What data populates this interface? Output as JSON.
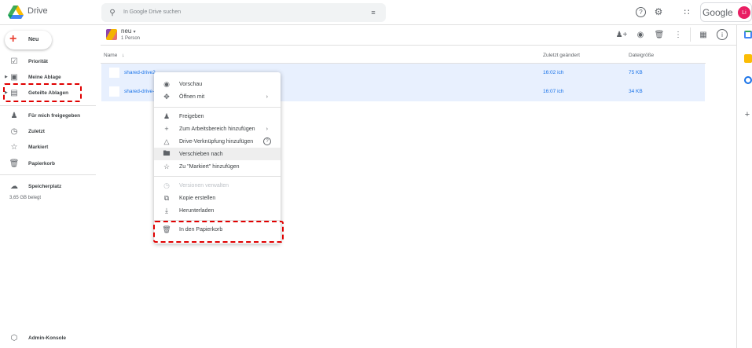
{
  "header": {
    "app_name": "Drive",
    "search_placeholder": "In Google Drive suchen",
    "account_brand": "Google",
    "avatar_initials": "Li"
  },
  "sidebar": {
    "new_label": "Neu",
    "items": [
      {
        "label": "Priorität"
      },
      {
        "label": "Meine Ablage"
      },
      {
        "label": "Geteilte Ablagen"
      },
      {
        "label": "Für mich freigegeben"
      },
      {
        "label": "Zuletzt"
      },
      {
        "label": "Markiert"
      },
      {
        "label": "Papierkorb"
      },
      {
        "label": "Speicherplatz"
      }
    ],
    "storage_used": "3,65 GB belegt",
    "admin_label": "Admin-Konsole"
  },
  "folder": {
    "name": "neu",
    "members": "1 Person"
  },
  "table": {
    "columns": [
      "Name",
      "Zuletzt geändert",
      "Dateigröße"
    ],
    "rows": [
      {
        "name": "shared-drive2",
        "modified": "16:02  ich",
        "size": "75 KB"
      },
      {
        "name": "shared-drive-",
        "modified": "16:07  ich",
        "size": "34 KB"
      }
    ]
  },
  "context_menu": {
    "items": [
      {
        "label": "Vorschau"
      },
      {
        "label": "Öffnen mit"
      },
      {
        "label": "Freigeben"
      },
      {
        "label": "Zum Arbeitsbereich hinzufügen"
      },
      {
        "label": "Drive-Verknüpfung hinzufügen"
      },
      {
        "label": "Verschieben nach"
      },
      {
        "label": "Zu \"Markiert\" hinzufügen"
      },
      {
        "label": "Versionen verwalten"
      },
      {
        "label": "Kopie erstellen"
      },
      {
        "label": "Herunterladen"
      },
      {
        "label": "In den Papierkorb"
      }
    ]
  },
  "colors": {
    "accent": "#1a73e8",
    "selection": "#e8f0fe",
    "highlight_dash": "#e00000",
    "avatar": "#e91e63"
  }
}
